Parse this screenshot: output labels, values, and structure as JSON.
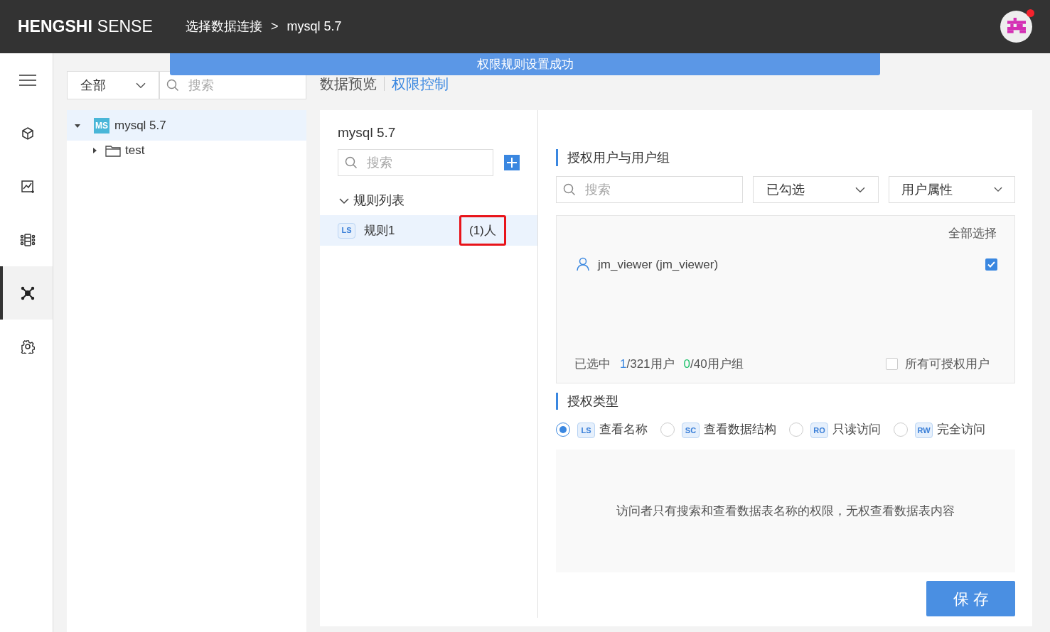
{
  "header": {
    "logo_bold": "HENGSHI",
    "logo_light": "SENSE",
    "breadcrumb": [
      "选择数据连接",
      ">",
      "mysql 5.7"
    ],
    "has_notification": true
  },
  "toast": "权限规则设置成功",
  "nav": [
    {
      "kind": "menu",
      "selected": false
    },
    {
      "kind": "cube",
      "selected": false
    },
    {
      "kind": "chart",
      "selected": false
    },
    {
      "kind": "pipeline",
      "selected": false
    },
    {
      "kind": "network",
      "selected": true
    },
    {
      "kind": "settings",
      "selected": false
    }
  ],
  "filter": {
    "value": "全部",
    "search_placeholder": "搜索"
  },
  "tree": [
    {
      "badge": "MS",
      "label": "mysql 5.7",
      "expanded": true,
      "selected": true,
      "children": [
        {
          "label": "test",
          "expanded": false,
          "selected": false
        }
      ]
    }
  ],
  "tabs": [
    {
      "label": "数据预览",
      "selected": false
    },
    {
      "label": "权限控制",
      "selected": true
    }
  ],
  "rules_panel": {
    "title": "mysql 5.7",
    "search_placeholder": "搜索",
    "section": "规则列表",
    "expanded": true,
    "rules": [
      {
        "badge": "LS",
        "name": "规则1",
        "count": "(1)人",
        "selected": true,
        "annotated": true
      }
    ]
  },
  "users_panel": {
    "title": "授权用户与用户组",
    "search_placeholder": "搜索",
    "filter_1": "已勾选",
    "filter_2": "用户属性",
    "select_all": "全部选择",
    "users": [
      {
        "name": "jm_viewer (jm_viewer)",
        "checked": true
      }
    ],
    "summary": {
      "label": "已选中",
      "users_selected": "1",
      "users_total": "/321用户",
      "groups_selected": "0",
      "groups_total": "/40用户组"
    },
    "all_users": {
      "label": "所有可授权用户",
      "checked": false
    }
  },
  "auth_panel": {
    "title": "授权类型",
    "options": [
      {
        "badge": "LS",
        "label": "查看名称",
        "selected": true
      },
      {
        "badge": "SC",
        "label": "查看数据结构",
        "selected": false
      },
      {
        "badge": "RO",
        "label": "只读访问",
        "selected": false
      },
      {
        "badge": "RW",
        "label": "完全访问",
        "selected": false
      }
    ],
    "description": "访问者只有搜索和查看数据表名称的权限，无权查看数据表内容"
  },
  "save_button": "保存"
}
